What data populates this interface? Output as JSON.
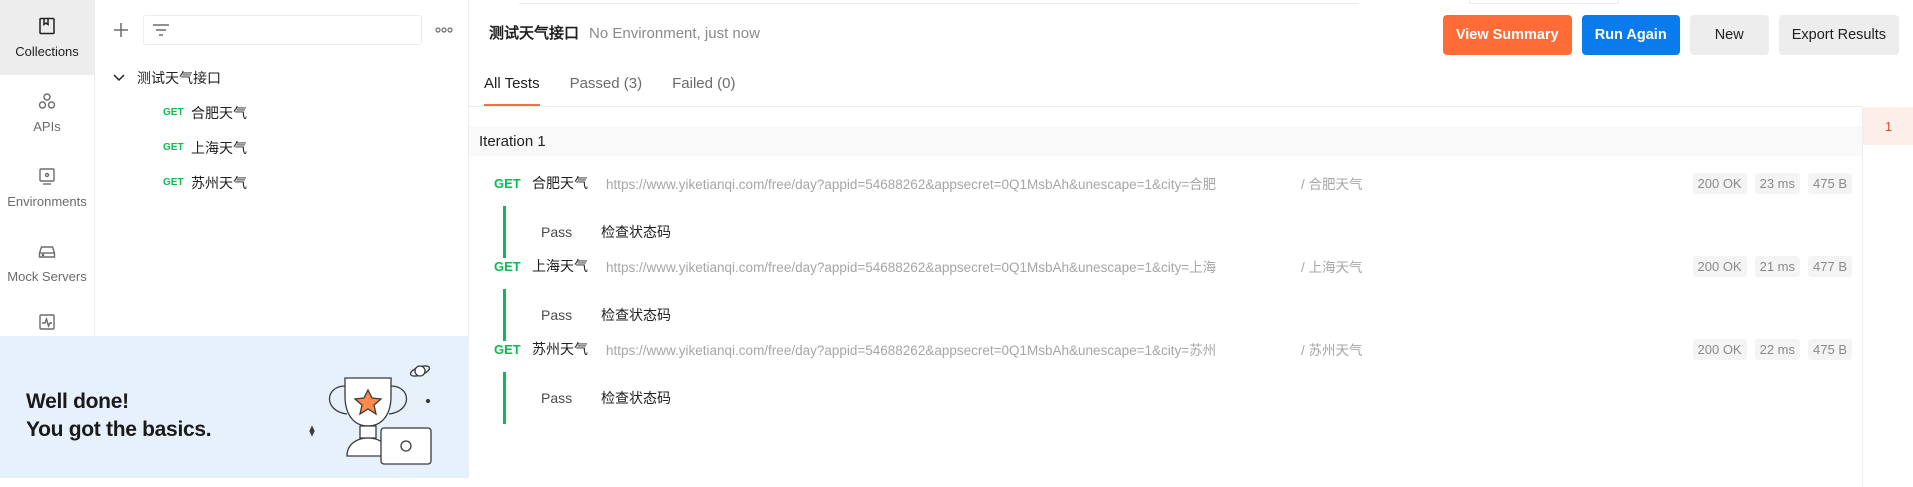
{
  "rail": {
    "items": [
      {
        "label": "Collections",
        "icon": "collections-icon"
      },
      {
        "label": "APIs",
        "icon": "apis-icon"
      },
      {
        "label": "Environments",
        "icon": "environments-icon"
      },
      {
        "label": "Mock Servers",
        "icon": "mock-servers-icon"
      },
      {
        "label": "",
        "icon": "monitors-icon"
      }
    ]
  },
  "tree": {
    "collection_name": "测试天气接口",
    "requests": [
      {
        "method": "GET",
        "name": "合肥天气"
      },
      {
        "method": "GET",
        "name": "上海天气"
      },
      {
        "method": "GET",
        "name": "苏州天气"
      }
    ]
  },
  "onboarding": {
    "line1": "Well done!",
    "line2": "You got the basics."
  },
  "runner": {
    "title": "测试天气接口",
    "meta": "No Environment, just now",
    "buttons": {
      "view_summary": "View Summary",
      "run_again": "Run Again",
      "new": "New",
      "export": "Export Results"
    },
    "tabs": [
      {
        "label": "All Tests"
      },
      {
        "label": "Passed (3)"
      },
      {
        "label": "Failed (0)"
      }
    ],
    "iteration_label": "Iteration 1",
    "iteration_number": "1",
    "results": [
      {
        "method": "GET",
        "name": "合肥天气",
        "url": "https://www.yiketianqi.com/free/day?appid=54688262&appsecret=0Q1MsbAh&unescape=1&city=合肥",
        "path": "/ 合肥天气",
        "status": "200 OK",
        "time": "23 ms",
        "size": "475 B",
        "test_status": "Pass",
        "test_name": "检查状态码"
      },
      {
        "method": "GET",
        "name": "上海天气",
        "url": "https://www.yiketianqi.com/free/day?appid=54688262&appsecret=0Q1MsbAh&unescape=1&city=上海",
        "path": "/ 上海天气",
        "status": "200 OK",
        "time": "21 ms",
        "size": "477 B",
        "test_status": "Pass",
        "test_name": "检查状态码"
      },
      {
        "method": "GET",
        "name": "苏州天气",
        "url": "https://www.yiketianqi.com/free/day?appid=54688262&appsecret=0Q1MsbAh&unescape=1&city=苏州",
        "path": "/ 苏州天气",
        "status": "200 OK",
        "time": "22 ms",
        "size": "475 B",
        "test_status": "Pass",
        "test_name": "检查状态码"
      }
    ]
  },
  "colors": {
    "accent_orange": "#ff6c37",
    "accent_blue": "#097bed",
    "pass_green": "#0cbb52"
  }
}
